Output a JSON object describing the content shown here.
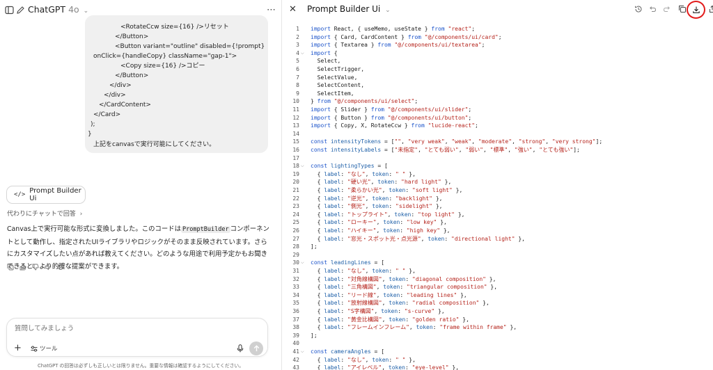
{
  "left": {
    "model_name": "ChatGPT",
    "model_version": "4o",
    "user_message_lines": [
      "<RotateCcw size={16} />リセット",
      "</Button>",
      "<Button variant=\"outline\" disabled={!prompt}",
      "onClick={handleCopy} className=\"gap-1\">",
      "<Copy size={16} />コピー",
      "</Button>",
      "</div>",
      "</div>",
      "</CardContent>",
      "</Card>",
      ");",
      "}",
      "上記をcanvasで実行可能にしてください。"
    ],
    "artifact_button_label": "Prompt Builder Ui",
    "reply_link": "代わりにチャットで回答",
    "reply_text_before": "Canvas上で実行可能な形式に変換しました。このコードは",
    "reply_inline_code": "PromptBuilder",
    "reply_text_after": "コンポーネントとして動作し、指定されたUIライブラリやロジックがそのまま反映されています。さらにカスタマイズしたい点があれば教えてください。どのような用途で利用予定かもお聞きできると、より的確な提案ができます。",
    "composer_placeholder": "質問してみましょう",
    "tools_label": "ツール",
    "disclaimer": "ChatGPT の回答は必ずしも正しいとは限りません。重要な情報は確認するようにしてください。"
  },
  "canvas": {
    "title": "Prompt Builder Ui",
    "code_lines": [
      "import React, { useMemo, useState } from \"react\";",
      "import { Card, CardContent } from \"@/components/ui/card\";",
      "import { Textarea } from \"@/components/ui/textarea\";",
      "import {",
      "  Select,",
      "  SelectTrigger,",
      "  SelectValue,",
      "  SelectContent,",
      "  SelectItem,",
      "} from \"@/components/ui/select\";",
      "import { Slider } from \"@/components/ui/slider\";",
      "import { Button } from \"@/components/ui/button\";",
      "import { Copy, X, RotateCcw } from \"lucide-react\";",
      "",
      "const intensityTokens = [\"\", \"very weak\", \"weak\", \"moderate\", \"strong\", \"very strong\"];",
      "const intensityLabels = [\"未指定\", \"とても弱い\", \"弱い\", \"標準\", \"強い\", \"とても強い\"];",
      "",
      "const lightingTypes = [",
      "  { label: \"なし\", token: \" \" },",
      "  { label: \"硬い光\", token: \"hard light\" },",
      "  { label: \"柔らかい光\", token: \"soft light\" },",
      "  { label: \"逆光\", token: \"backlight\" },",
      "  { label: \"側光\", token: \"sidelight\" },",
      "  { label: \"トップライト\", token: \"top light\" },",
      "  { label: \"ローキー\", token: \"low key\" },",
      "  { label: \"ハイキー\", token: \"high key\" },",
      "  { label: \"窓光・スポット光・点光源\", token: \"directional light\" },",
      "];",
      "",
      "const leadingLines = [",
      "  { label: \"なし\", token: \" \" },",
      "  { label: \"対角線構図\", token: \"diagonal composition\" },",
      "  { label: \"三角構図\", token: \"triangular composition\" },",
      "  { label: \"リード線\", token: \"leading lines\" },",
      "  { label: \"放射線構図\", token: \"radial composition\" },",
      "  { label: \"S字構図\", token: \"s-curve\" },",
      "  { label: \"黄金比構図\", token: \"golden ratio\" },",
      "  { label: \"フレームインフレーム\", token: \"frame within frame\" },",
      "];",
      "",
      "const cameraAngles = [",
      "  { label: \"なし\", token: \" \" },",
      "  { label: \"アイレベル\", token: \"eye-level\" },"
    ],
    "fold_lines": [
      4,
      18,
      30,
      41
    ]
  }
}
